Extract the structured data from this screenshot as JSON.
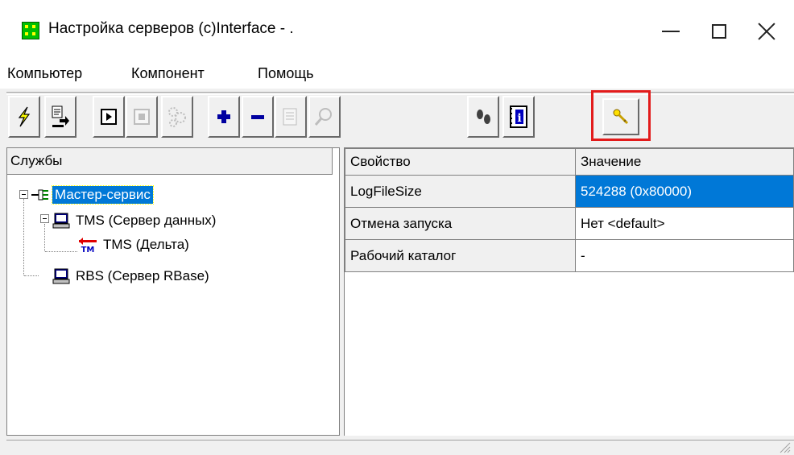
{
  "window": {
    "title": "Настройка серверов (c)Interface - .",
    "minimize_icon": "minimize-icon",
    "maximize_icon": "maximize-icon",
    "close_icon": "close-icon"
  },
  "menu": {
    "items": [
      "Компьютер",
      "Компонент",
      "Помощь"
    ]
  },
  "toolbar": {
    "buttons": [
      {
        "icon": "lightning-icon",
        "enabled": true
      },
      {
        "icon": "export-icon",
        "enabled": true
      },
      {
        "icon": "start-icon",
        "enabled": true
      },
      {
        "icon": "stop-icon",
        "enabled": false
      },
      {
        "icon": "settings-map-icon",
        "enabled": false
      },
      {
        "icon": "add-icon",
        "enabled": true
      },
      {
        "icon": "remove-icon",
        "enabled": true
      },
      {
        "icon": "properties-icon",
        "enabled": false
      },
      {
        "icon": "find-icon",
        "enabled": false
      },
      {
        "icon": "footprints-icon",
        "enabled": true
      },
      {
        "icon": "info-icon",
        "enabled": true
      },
      {
        "icon": "key-icon",
        "enabled": true,
        "highlighted": true
      }
    ],
    "highlight_color": "#e21b1b"
  },
  "tree": {
    "header": "Службы",
    "nodes": [
      {
        "label": "Мастер-сервис",
        "icon": "network-icon",
        "selected": true
      },
      {
        "label": "TMS (Сервер данных)",
        "icon": "computer-icon"
      },
      {
        "label": "TMS (Дельта)",
        "icon": "tm-delta-icon",
        "icon_text": "TM"
      },
      {
        "label": "RBS (Сервер RBase)",
        "icon": "computer-icon"
      }
    ]
  },
  "properties": {
    "headers": [
      "Свойство",
      "Значение"
    ],
    "rows": [
      {
        "name": "LogFileSize",
        "value": "524288 (0x80000)",
        "selected": true
      },
      {
        "name": "Отмена запуска",
        "value": "Нет <default>"
      },
      {
        "name": "Рабочий каталог",
        "value": "-"
      }
    ]
  },
  "colors": {
    "selection": "#0078d7",
    "face": "#f0f0f0"
  }
}
